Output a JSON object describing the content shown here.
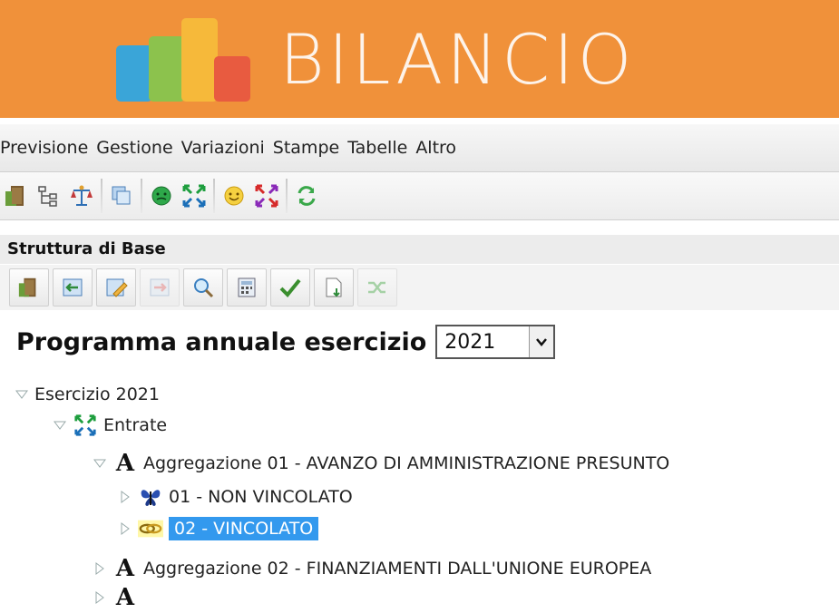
{
  "app": {
    "title": "BILANCIO"
  },
  "menu": {
    "items": [
      "Previsione",
      "Gestione",
      "Variazioni",
      "Stampe",
      "Tabelle",
      "Altro"
    ]
  },
  "toolbar": {
    "icons": [
      "exit-door-icon",
      "tree-structure-icon",
      "balance-scale-icon",
      "copy-windows-icon",
      "green-face-icon",
      "green-arrows-icon",
      "smiley-face-icon",
      "red-arrows-icon",
      "refresh-icon"
    ]
  },
  "section": {
    "title": "Struttura di Base",
    "icons": [
      "exit-door-icon",
      "back-arrow-icon",
      "edit-icon",
      "forward-icon",
      "search-icon",
      "calculator-icon",
      "checkmark-icon",
      "export-icon",
      "shuffle-icon"
    ]
  },
  "program": {
    "label": "Programma annuale esercizio",
    "year": "2021"
  },
  "tree": [
    {
      "label": "Esercizio 2021",
      "expanded": true,
      "level": 0
    },
    {
      "label": "Entrate",
      "expanded": true,
      "level": 1,
      "icon": "green-arrows-icon"
    },
    {
      "label": "Aggregazione 01 - AVANZO DI AMMINISTRAZIONE PRESUNTO",
      "expanded": true,
      "level": 2,
      "icon": "letter-a-icon"
    },
    {
      "label": "01 - NON VINCOLATO",
      "expanded": false,
      "level": 3,
      "icon": "butterfly-icon"
    },
    {
      "label": "02 - VINCOLATO",
      "expanded": false,
      "level": 3,
      "icon": "chain-link-icon",
      "selected": true
    },
    {
      "label": "Aggregazione 02 - FINANZIAMENTI DALL'UNIONE EUROPEA",
      "expanded": false,
      "level": 2,
      "icon": "letter-a-icon"
    }
  ],
  "colors": {
    "banner": "#f0913a",
    "selection": "#3399ee"
  }
}
